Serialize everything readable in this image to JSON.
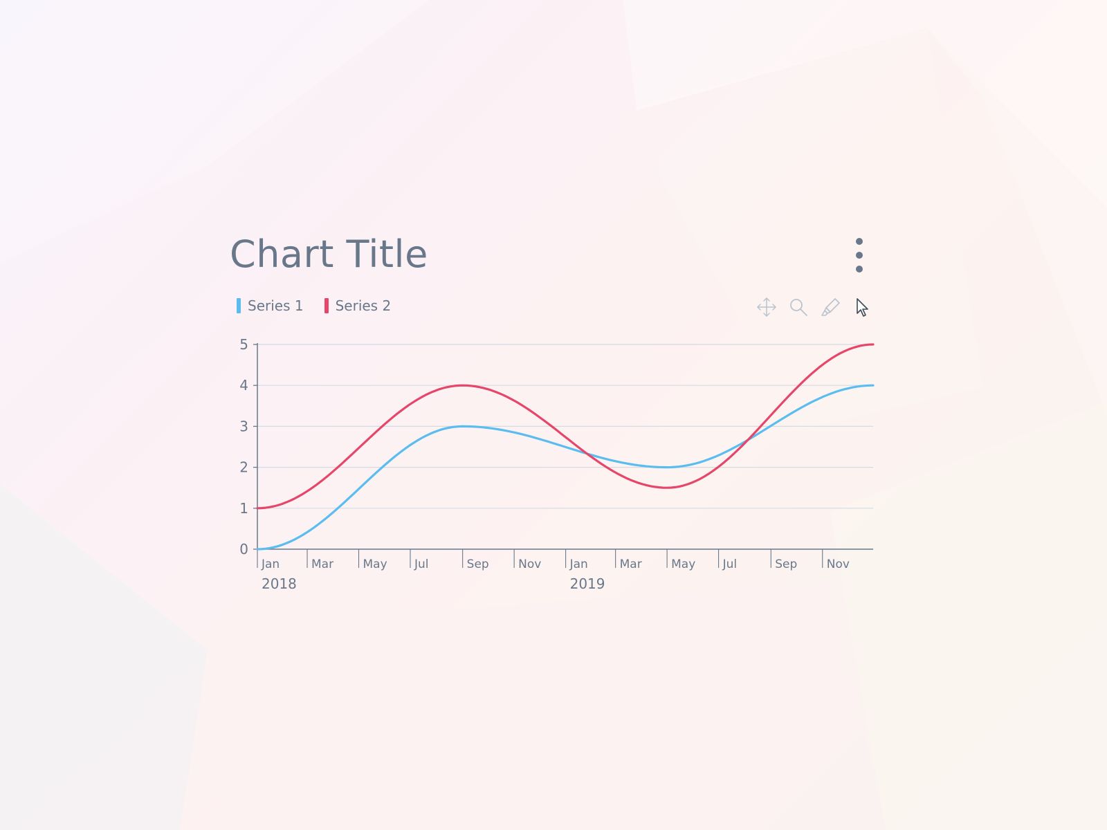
{
  "colors": {
    "series_1": "#5bbcf0",
    "series_2": "#e5466a",
    "text": "#68788a",
    "grid": "#d3dbe3",
    "axis": "#68788a"
  },
  "chart_title": "Chart Title",
  "menu_icon": "more-vertical-icon",
  "legend": [
    {
      "label": "Series 1",
      "color": "#5bbcf0"
    },
    {
      "label": "Series 2",
      "color": "#e5466a"
    }
  ],
  "toolbar": [
    {
      "name": "pan-tool-button",
      "icon": "move-arrows-icon",
      "active": false
    },
    {
      "name": "zoom-tool-button",
      "icon": "magnifier-icon",
      "active": false
    },
    {
      "name": "highlight-tool-button",
      "icon": "highlighter-icon",
      "active": false
    },
    {
      "name": "select-tool-button",
      "icon": "cursor-arrow-icon",
      "active": true
    }
  ],
  "chart_data": {
    "type": "line",
    "title": "Chart Title",
    "xlabel": "",
    "ylabel": "",
    "x_range": [
      "2018-01-01",
      "2019-12-31"
    ],
    "ylim": [
      0,
      5
    ],
    "yticks": [
      0,
      1,
      2,
      3,
      4,
      5
    ],
    "grid": true,
    "legend_position": "top-left",
    "x_ticks": [
      {
        "date": "2018-01-01",
        "label": "Jan"
      },
      {
        "date": "2018-03-01",
        "label": "Mar"
      },
      {
        "date": "2018-05-01",
        "label": "May"
      },
      {
        "date": "2018-07-01",
        "label": "Jul"
      },
      {
        "date": "2018-09-01",
        "label": "Sep"
      },
      {
        "date": "2018-11-01",
        "label": "Nov"
      },
      {
        "date": "2019-01-01",
        "label": "Jan"
      },
      {
        "date": "2019-03-01",
        "label": "Mar"
      },
      {
        "date": "2019-05-01",
        "label": "May"
      },
      {
        "date": "2019-07-01",
        "label": "Jul"
      },
      {
        "date": "2019-09-01",
        "label": "Sep"
      },
      {
        "date": "2019-11-01",
        "label": "Nov"
      }
    ],
    "year_labels": [
      {
        "date": "2018-01-01",
        "label": "2018"
      },
      {
        "date": "2019-01-01",
        "label": "2019"
      }
    ],
    "series": [
      {
        "name": "Series 1",
        "color": "#5bbcf0",
        "points": [
          {
            "x": "2018-01-01",
            "y": 0
          },
          {
            "x": "2018-09-01",
            "y": 3
          },
          {
            "x": "2019-05-01",
            "y": 2
          },
          {
            "x": "2019-12-31",
            "y": 4
          }
        ]
      },
      {
        "name": "Series 2",
        "color": "#e5466a",
        "points": [
          {
            "x": "2018-01-01",
            "y": 1
          },
          {
            "x": "2018-09-01",
            "y": 4
          },
          {
            "x": "2019-05-01",
            "y": 1.5
          },
          {
            "x": "2019-12-31",
            "y": 5
          }
        ]
      }
    ]
  }
}
